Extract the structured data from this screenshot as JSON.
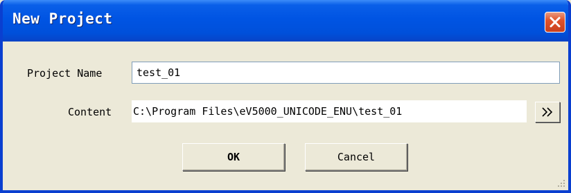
{
  "window": {
    "title": "New Project"
  },
  "form": {
    "project_name_label": "Project Name",
    "project_name_value": "test_01",
    "content_label": "Content",
    "content_value": "C:\\Program Files\\eV5000_UNICODE_ENU\\test_01",
    "browse_label": ">>"
  },
  "buttons": {
    "ok_label": "OK",
    "cancel_label": "Cancel"
  },
  "colors": {
    "titlebar": "#0054E3",
    "close_button": "#E1532B",
    "dialog_background": "#ECE9D8"
  }
}
